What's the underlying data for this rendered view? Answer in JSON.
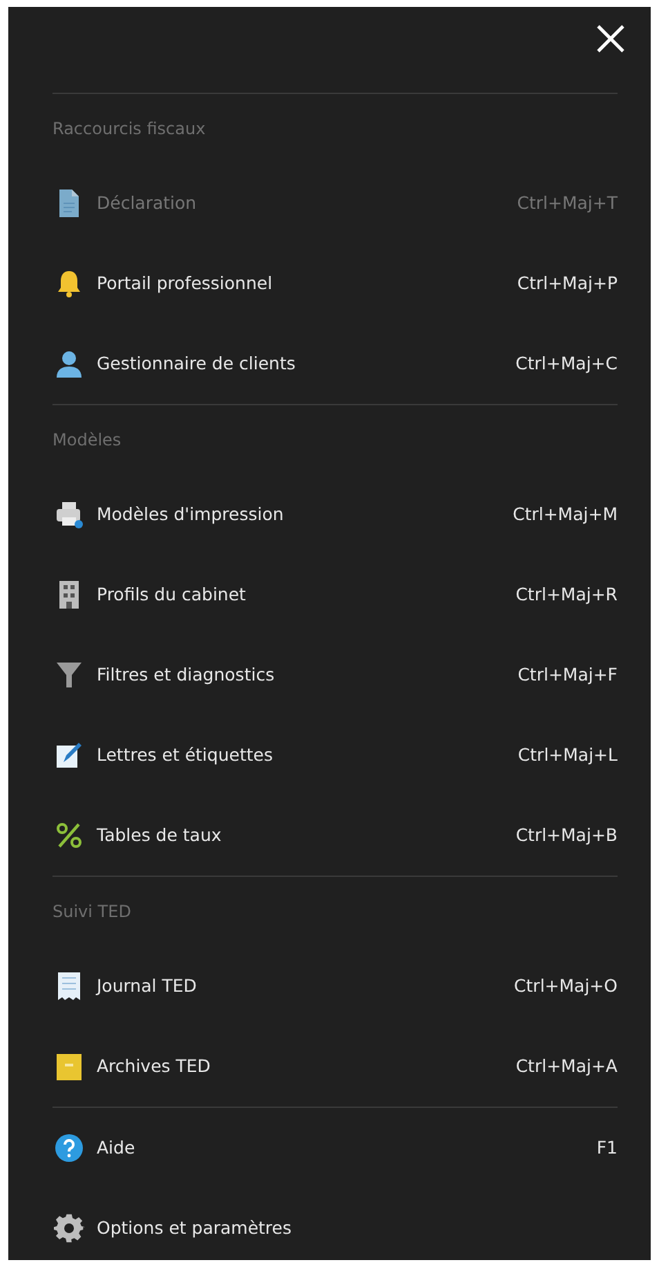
{
  "groups": [
    {
      "title": "Raccourcis fiscaux",
      "items": [
        {
          "label": "Déclaration",
          "shortcut": "Ctrl+Maj+T",
          "disabled": true
        },
        {
          "label": "Portail professionnel",
          "shortcut": "Ctrl+Maj+P",
          "disabled": false
        },
        {
          "label": "Gestionnaire de clients",
          "shortcut": "Ctrl+Maj+C",
          "disabled": false
        }
      ]
    },
    {
      "title": "Modèles",
      "items": [
        {
          "label": "Modèles d'impression",
          "shortcut": "Ctrl+Maj+M",
          "disabled": false
        },
        {
          "label": "Profils du cabinet",
          "shortcut": "Ctrl+Maj+R",
          "disabled": false
        },
        {
          "label": "Filtres et diagnostics",
          "shortcut": "Ctrl+Maj+F",
          "disabled": false
        },
        {
          "label": "Lettres et étiquettes",
          "shortcut": "Ctrl+Maj+L",
          "disabled": false
        },
        {
          "label": "Tables de taux",
          "shortcut": "Ctrl+Maj+B",
          "disabled": false
        }
      ]
    },
    {
      "title": "Suivi TED",
      "items": [
        {
          "label": "Journal TED",
          "shortcut": "Ctrl+Maj+O",
          "disabled": false
        },
        {
          "label": "Archives TED",
          "shortcut": "Ctrl+Maj+A",
          "disabled": false
        }
      ]
    },
    {
      "items": [
        {
          "label": "Aide",
          "shortcut": "F1",
          "disabled": false
        },
        {
          "label": "Options et paramètres",
          "disabled": false
        }
      ]
    }
  ]
}
